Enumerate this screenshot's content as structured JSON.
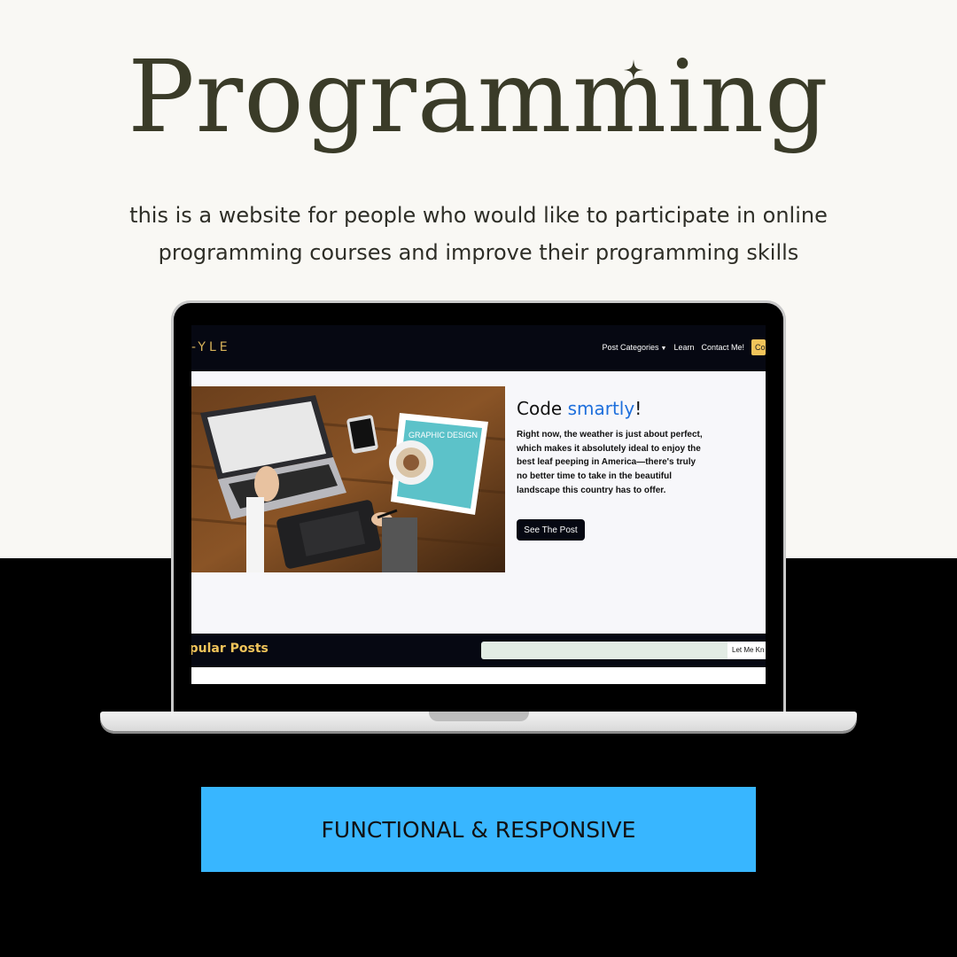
{
  "headline": "Programming",
  "tagline": {
    "line1": "this is a website for people who would like to participate in online",
    "line2": "programming courses and improve their programming skills"
  },
  "site": {
    "brand": "-YLE",
    "nav": {
      "categories": "Post Categories",
      "learn": "Learn",
      "contact": "Contact Me!",
      "cta": "Co"
    },
    "hero": {
      "title_start": "Code ",
      "title_accent": "smartly",
      "title_end": "!",
      "text": "Right now, the weather is just about perfect, which makes it absolutely ideal to enjoy the best leaf peeping in America—there's truly no better time to take in the beautiful landscape this country has to offer.",
      "button": "See The Post",
      "image_text": "GRAPHIC DESIGN"
    },
    "popular": {
      "title": "opular Posts",
      "button": "Let Me Kn"
    }
  },
  "badge": "FUNCTIONAL & RESPONSIVE",
  "colors": {
    "page_bg_top": "#f9f8f4",
    "page_bg_bottom": "#000000",
    "headline": "#3a3b28",
    "nav_bg": "#060812",
    "brand_gold": "#d9b45a",
    "accent_blue": "#1e6fdc",
    "badge_bg": "#38b6ff"
  }
}
